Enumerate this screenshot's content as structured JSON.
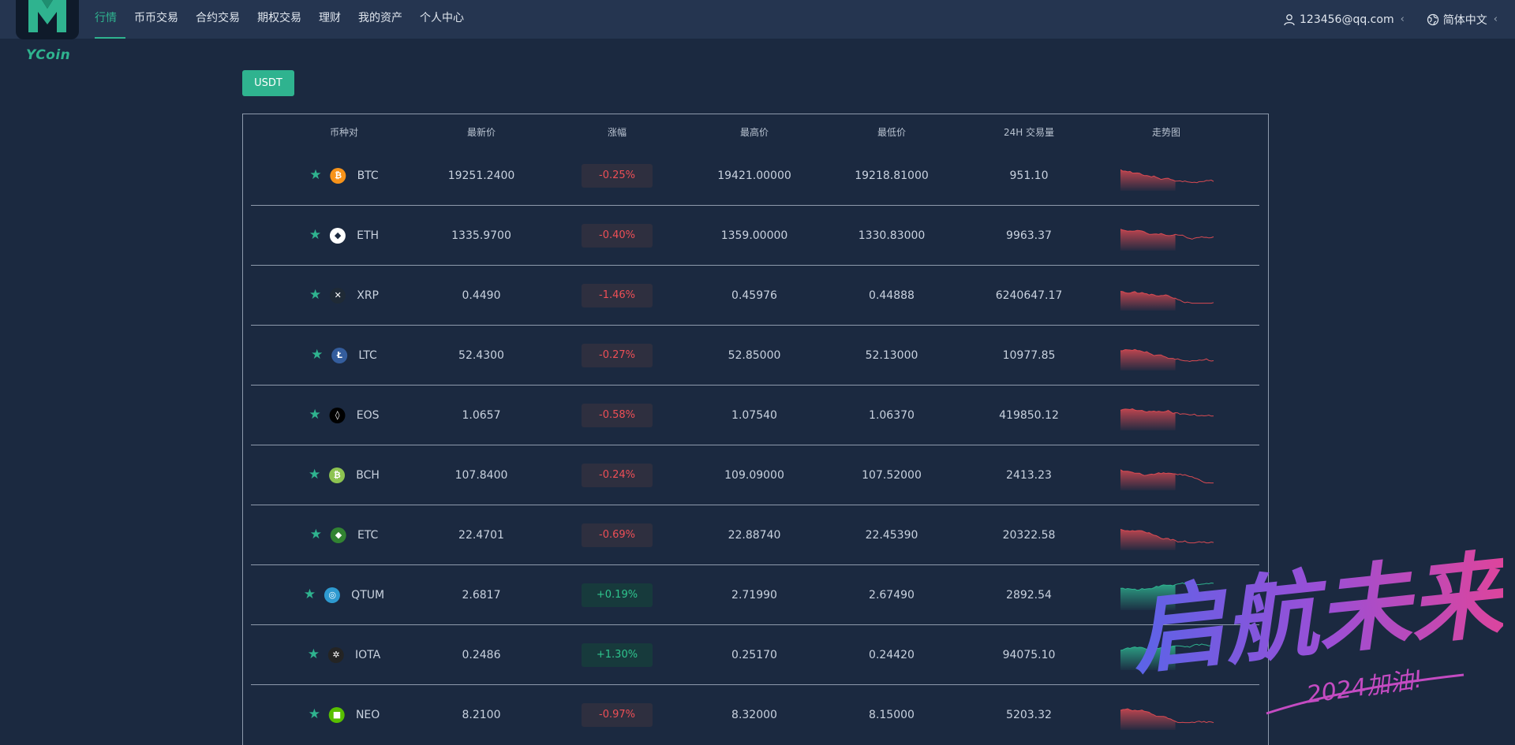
{
  "brand": {
    "name": "YCoin"
  },
  "nav": {
    "items": [
      "行情",
      "币币交易",
      "合约交易",
      "期权交易",
      "理财",
      "我的资产",
      "个人中心"
    ],
    "active_index": 0
  },
  "user": {
    "email": "123456@qq.com",
    "icon": "user-icon"
  },
  "language": {
    "label": "简体中文",
    "icon": "globe-icon"
  },
  "market_tab": {
    "label": "USDT"
  },
  "table": {
    "headers": [
      "币种对",
      "最新价",
      "涨幅",
      "最高价",
      "最低价",
      "24H 交易量",
      "走势图"
    ],
    "rows": [
      {
        "symbol": "BTC",
        "icon_color": "#f7931a",
        "glyph": "₿",
        "last": "19251.2400",
        "change": "-0.25%",
        "direction": "down",
        "high": "19421.00000",
        "low": "19218.81000",
        "volume": "951.10"
      },
      {
        "symbol": "ETH",
        "icon_color": "#ffffff",
        "glyph": "◆",
        "last": "1335.9700",
        "change": "-0.40%",
        "direction": "down",
        "high": "1359.00000",
        "low": "1330.83000",
        "volume": "9963.37"
      },
      {
        "symbol": "XRP",
        "icon_color": "#1f2a36",
        "glyph": "✕",
        "last": "0.4490",
        "change": "-1.46%",
        "direction": "down",
        "high": "0.45976",
        "low": "0.44888",
        "volume": "6240647.17"
      },
      {
        "symbol": "LTC",
        "icon_color": "#345d9d",
        "glyph": "Ł",
        "last": "52.4300",
        "change": "-0.27%",
        "direction": "down",
        "high": "52.85000",
        "low": "52.13000",
        "volume": "10977.85"
      },
      {
        "symbol": "EOS",
        "icon_color": "#000000",
        "glyph": "◊",
        "last": "1.0657",
        "change": "-0.58%",
        "direction": "down",
        "high": "1.07540",
        "low": "1.06370",
        "volume": "419850.12"
      },
      {
        "symbol": "BCH",
        "icon_color": "#8dc351",
        "glyph": "₿",
        "last": "107.8400",
        "change": "-0.24%",
        "direction": "down",
        "high": "109.09000",
        "low": "107.52000",
        "volume": "2413.23"
      },
      {
        "symbol": "ETC",
        "icon_color": "#328332",
        "glyph": "◆",
        "last": "22.4701",
        "change": "-0.69%",
        "direction": "down",
        "high": "22.88740",
        "low": "22.45390",
        "volume": "20322.58"
      },
      {
        "symbol": "QTUM",
        "icon_color": "#2e9ad0",
        "glyph": "◎",
        "last": "2.6817",
        "change": "+0.19%",
        "direction": "up",
        "high": "2.71990",
        "low": "2.67490",
        "volume": "2892.54"
      },
      {
        "symbol": "IOTA",
        "icon_color": "#242424",
        "glyph": "✲",
        "last": "0.2486",
        "change": "+1.30%",
        "direction": "up",
        "high": "0.25170",
        "low": "0.24420",
        "volume": "94075.10"
      },
      {
        "symbol": "NEO",
        "icon_color": "#58bf00",
        "glyph": "■",
        "last": "8.2100",
        "change": "-0.97%",
        "direction": "down",
        "high": "8.32000",
        "low": "8.15000",
        "volume": "5203.32"
      }
    ]
  },
  "colors": {
    "accent": "#2fb38f",
    "down": "#ee4f56",
    "up": "#2fc58e",
    "background": "#1b2940"
  },
  "watermark": {
    "main": "启航未来",
    "sub": "2024加油!"
  }
}
